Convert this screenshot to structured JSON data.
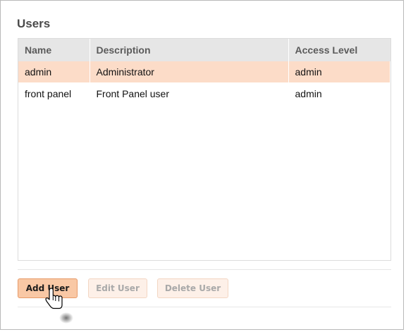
{
  "section": {
    "title": "Users"
  },
  "table": {
    "columns": [
      "Name",
      "Description",
      "Access Level"
    ],
    "rows": [
      {
        "name": "admin",
        "description": "Administrator",
        "access_level": "admin",
        "selected": true
      },
      {
        "name": "front panel",
        "description": "Front Panel user",
        "access_level": "admin",
        "selected": false
      }
    ]
  },
  "buttons": {
    "add_user": "Add User",
    "edit_user": "Edit User",
    "delete_user": "Delete User"
  },
  "colors": {
    "selected_row": "#fcdcc8",
    "primary_button": "#f9c8a5",
    "header_bg": "#e6e6e6"
  },
  "cursor": {
    "icon": "hand-pointer-icon"
  }
}
